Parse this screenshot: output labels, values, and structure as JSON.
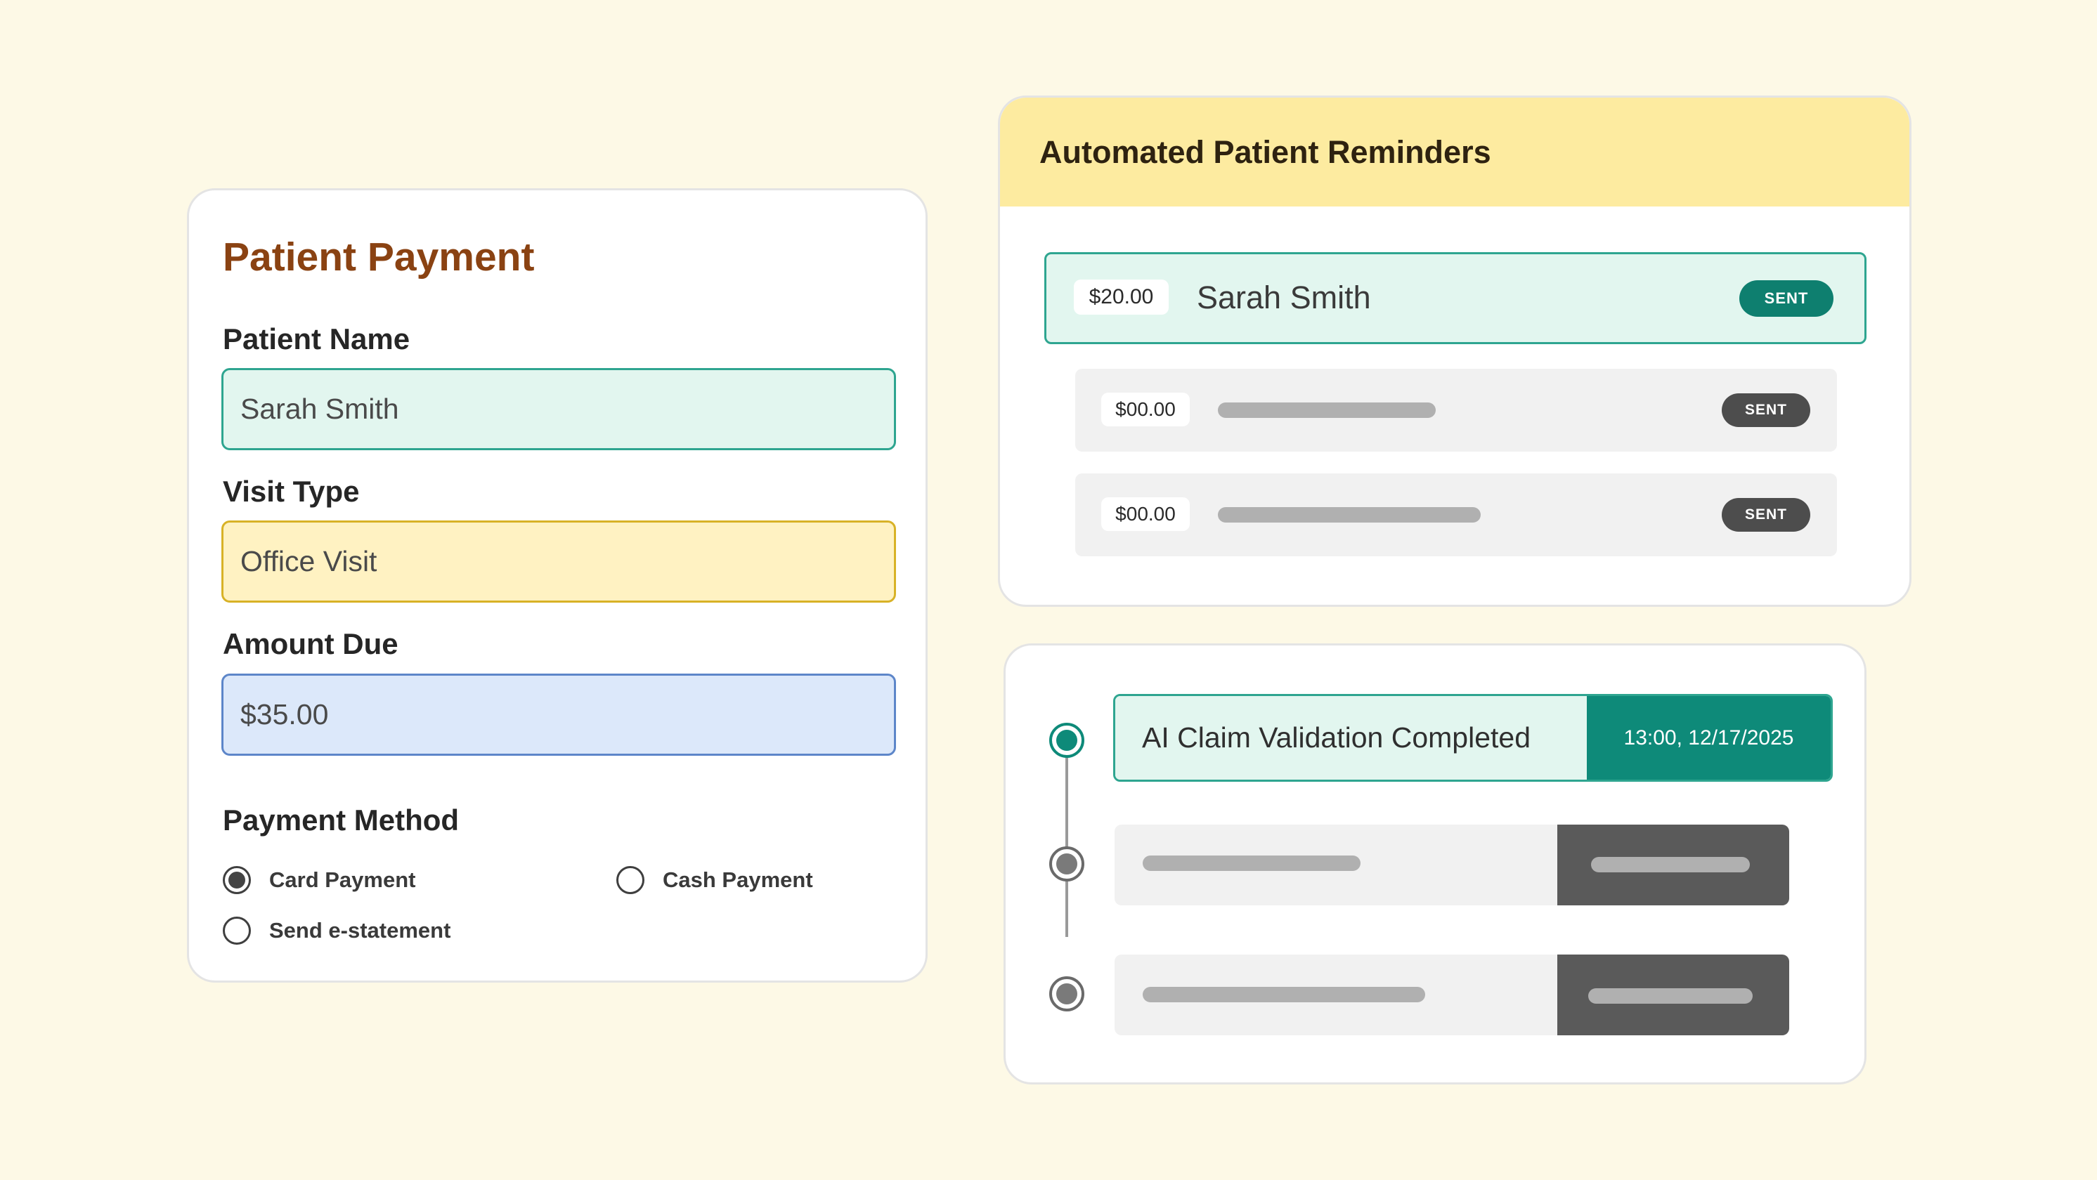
{
  "payment": {
    "title": "Patient Payment",
    "name_label": "Patient Name",
    "name_value": "Sarah Smith",
    "visit_label": "Visit Type",
    "visit_value": "Office Visit",
    "amount_label": "Amount Due",
    "amount_value": "$35.00",
    "method_label": "Payment Method",
    "options": [
      {
        "label": "Card Payment",
        "selected": true
      },
      {
        "label": "Cash Payment",
        "selected": false
      },
      {
        "label": "Send e-statement",
        "selected": false
      }
    ]
  },
  "reminders": {
    "title": "Automated Patient Reminders",
    "rows": [
      {
        "amount": "$20.00",
        "name": "Sarah Smith",
        "status": "SENT"
      },
      {
        "amount": "$00.00",
        "status": "SENT"
      },
      {
        "amount": "$00.00",
        "status": "SENT"
      }
    ]
  },
  "timeline": {
    "items": [
      {
        "label": "AI Claim Validation Completed",
        "timestamp": "13:00, 12/17/2025"
      }
    ]
  },
  "colors": {
    "background": "#fdf9e6",
    "brand_title": "#8a4212",
    "teal_accent": "#0e8a79",
    "teal_light": "#e2f6ef",
    "yellow_header": "#fdeba0",
    "blue_field": "#dce8fa",
    "dark_gray": "#5a5a5a"
  }
}
